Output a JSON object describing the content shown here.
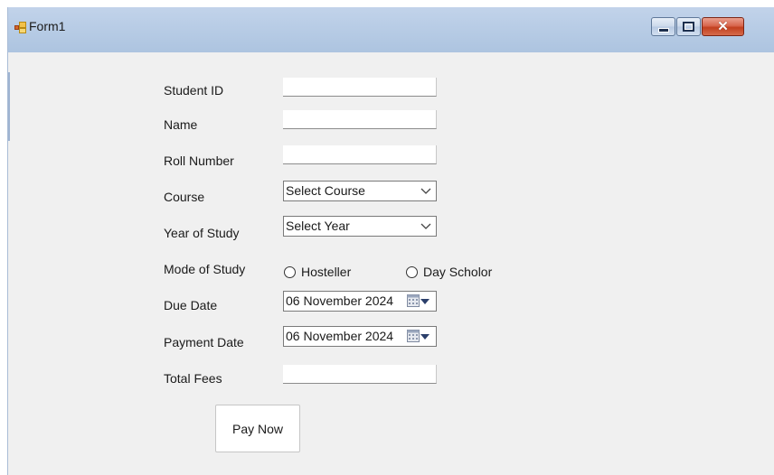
{
  "window": {
    "title": "Form1",
    "controls": [
      "minimize",
      "maximize",
      "close"
    ]
  },
  "form": {
    "fields": {
      "student_id": {
        "label": "Student ID",
        "value": ""
      },
      "name": {
        "label": "Name",
        "value": ""
      },
      "roll_number": {
        "label": "Roll Number",
        "value": ""
      },
      "course": {
        "label": "Course",
        "selected": "Select Course"
      },
      "year_of_study": {
        "label": "Year of Study",
        "selected": "Select Year"
      },
      "mode_of_study": {
        "label": "Mode of Study",
        "options": [
          "Hosteller",
          "Day Scholor"
        ],
        "selected": null
      },
      "due_date": {
        "label": "Due Date",
        "value": "06 November 2024"
      },
      "payment_date": {
        "label": "Payment Date",
        "value": "06 November 2024"
      },
      "total_fees": {
        "label": "Total Fees",
        "value": ""
      }
    },
    "pay_button_label": "Pay Now"
  },
  "icons": {
    "app": "form-app-icon",
    "dropdown": "chevron-down-icon",
    "calendar": "calendar-icon"
  },
  "colors": {
    "titlebar": "#b9cde6",
    "window_bg": "#f0f0f0",
    "close_button": "#c2401f"
  }
}
